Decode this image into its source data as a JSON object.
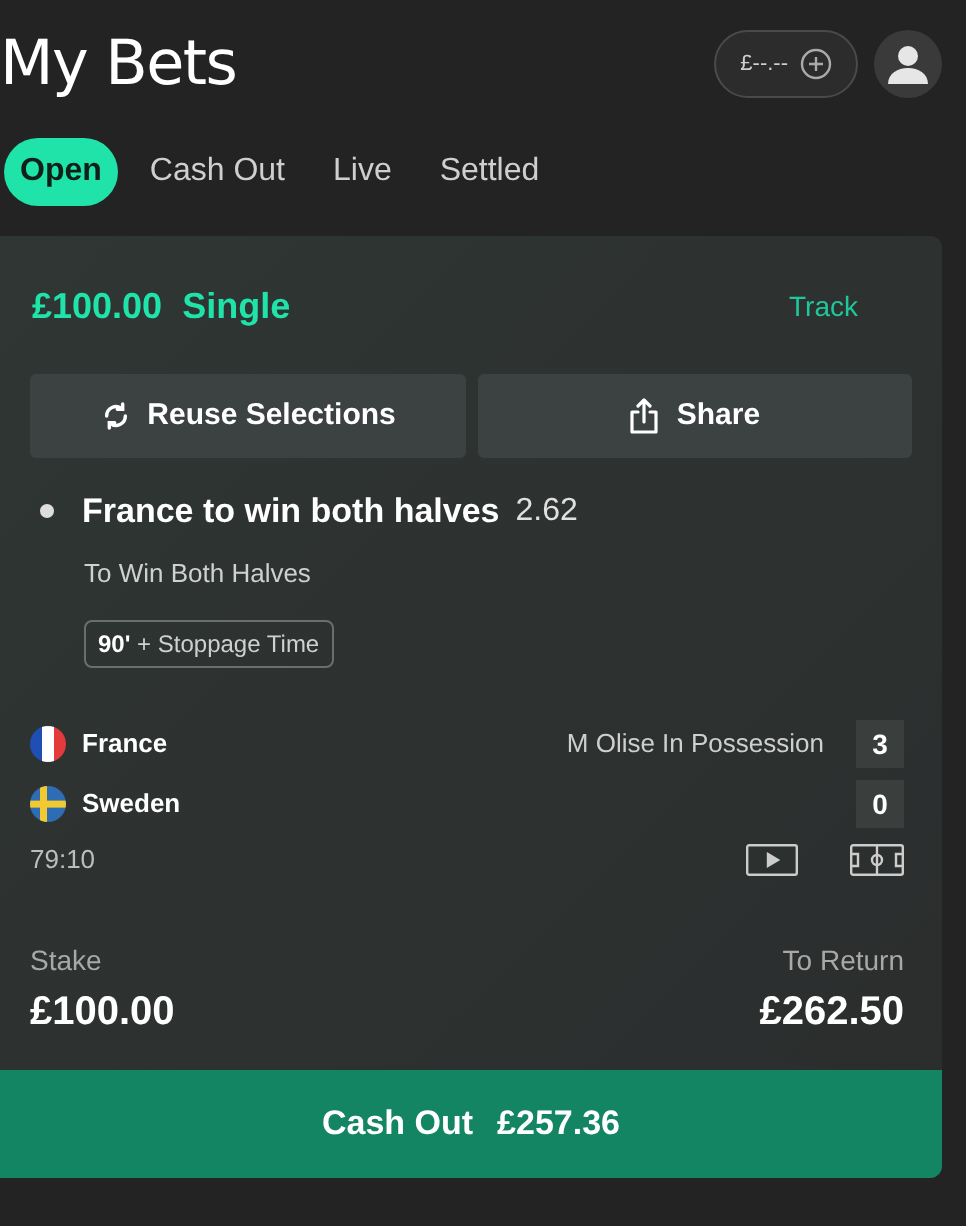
{
  "header": {
    "title": "My Bets",
    "balance": "£--.--"
  },
  "tabs": [
    {
      "label": "Open",
      "selected": true
    },
    {
      "label": "Cash Out",
      "selected": false
    },
    {
      "label": "Live",
      "selected": false
    },
    {
      "label": "Settled",
      "selected": false
    }
  ],
  "bet": {
    "title": "£100.00  Single",
    "track": "Track",
    "actions": [
      {
        "kind": "reuse",
        "label": "Reuse Selections"
      },
      {
        "kind": "share",
        "label": "Share"
      }
    ],
    "selection": {
      "name": "France to win both halves",
      "odds": "2.62",
      "market": "To Win Both Halves",
      "tag_bold": "90'",
      "tag": "+ Stoppage Time"
    },
    "teams": [
      {
        "name": "France",
        "kind": "france",
        "status": "M Olise In Possession",
        "score": "3"
      },
      {
        "name": "Sweden",
        "kind": "sweden",
        "score": "0"
      }
    ],
    "clock": "79:10",
    "stake_label": "Stake",
    "stake": "£100.00",
    "return_label": "To Return",
    "return": "£262.50",
    "cashout_label": "Cash Out",
    "cashout": "£257.36"
  }
}
